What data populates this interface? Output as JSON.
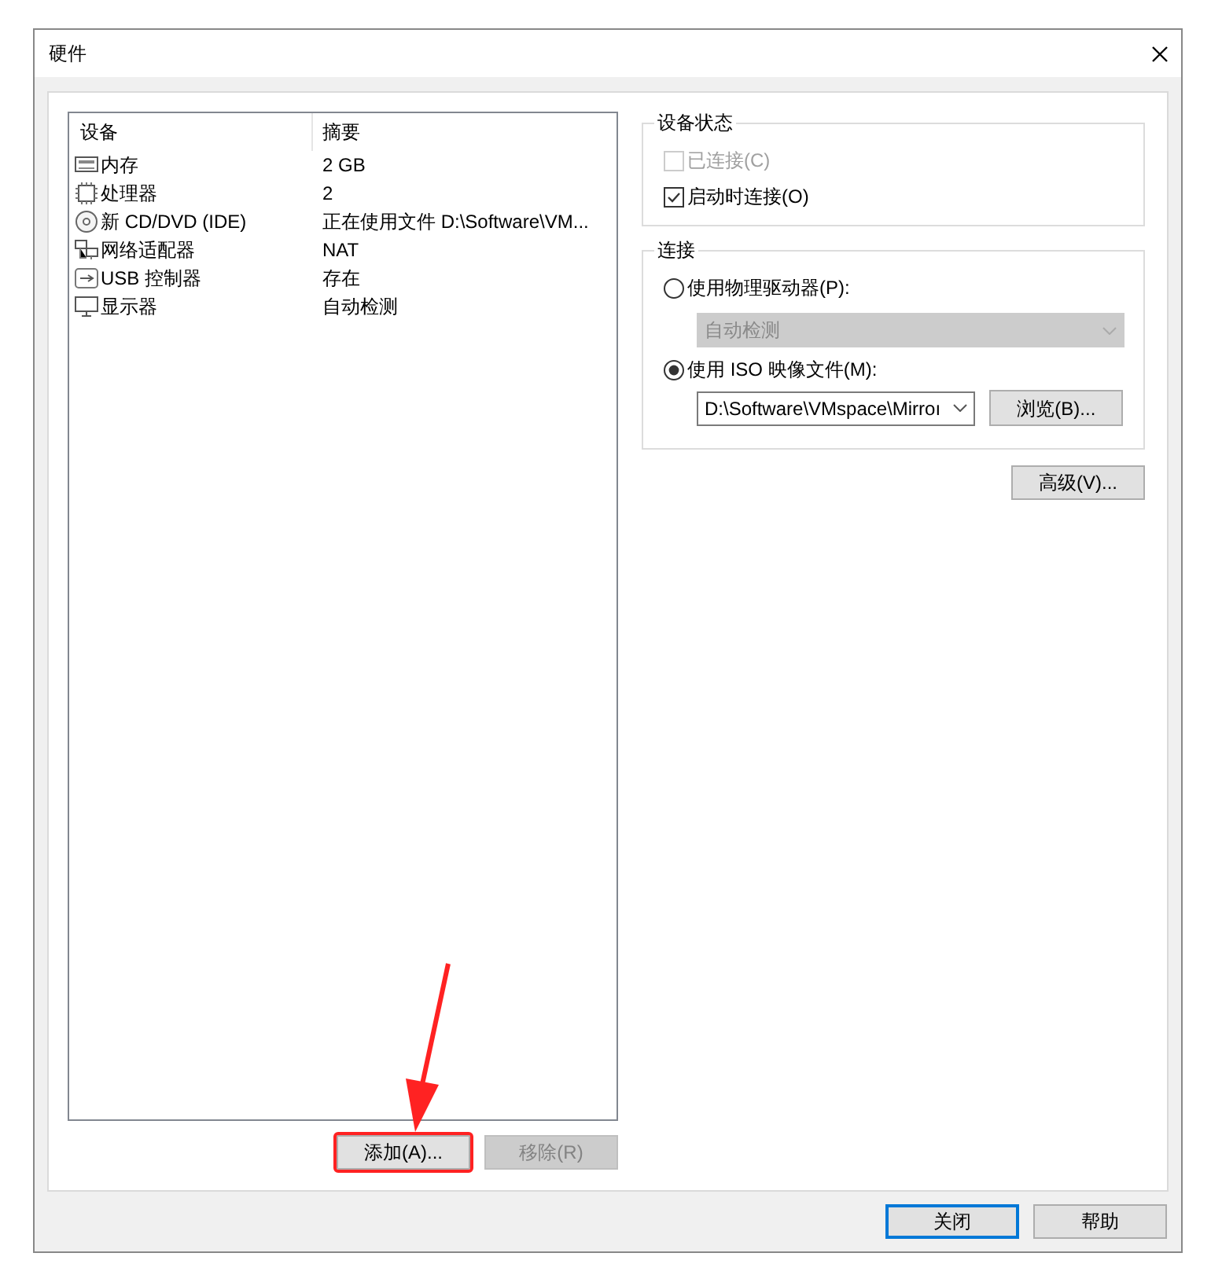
{
  "window": {
    "title": "硬件"
  },
  "device_list": {
    "columns": [
      "设备",
      "摘要"
    ],
    "rows": [
      {
        "kind": "memory",
        "device": "内存",
        "summary": "2 GB"
      },
      {
        "kind": "cpu",
        "device": "处理器",
        "summary": "2"
      },
      {
        "kind": "disc",
        "device": "新 CD/DVD (IDE)",
        "summary": "正在使用文件 D:\\Software\\VM..."
      },
      {
        "kind": "network",
        "device": "网络适配器",
        "summary": "NAT"
      },
      {
        "kind": "usb",
        "device": "USB 控制器",
        "summary": "存在"
      },
      {
        "kind": "display",
        "device": "显示器",
        "summary": "自动检测"
      }
    ]
  },
  "list_buttons": [
    {
      "label": "添加(A)...",
      "disabled": false,
      "highlighted": true
    },
    {
      "label": "移除(R)",
      "disabled": true,
      "highlighted": false
    }
  ],
  "device_status": {
    "title": "设备状态",
    "checkboxes": [
      {
        "label": "已连接(C)",
        "checked": false,
        "disabled": true
      },
      {
        "label": "启动时连接(O)",
        "checked": true,
        "disabled": false
      }
    ]
  },
  "connection": {
    "title": "连接",
    "physical": {
      "label": "使用物理驱动器(P):",
      "selected": false,
      "dropdown": {
        "value": "自动检测",
        "disabled": true
      }
    },
    "iso": {
      "label": "使用 ISO 映像文件(M):",
      "selected": true,
      "dropdown": {
        "value": "D:\\Software\\VMspace\\Mirroı",
        "disabled": false
      },
      "browse_button": "浏览(B)..."
    }
  },
  "advanced_button": "高级(V)...",
  "footer_buttons": [
    {
      "label": "关闭",
      "default": true
    },
    {
      "label": "帮助",
      "default": false
    }
  ]
}
